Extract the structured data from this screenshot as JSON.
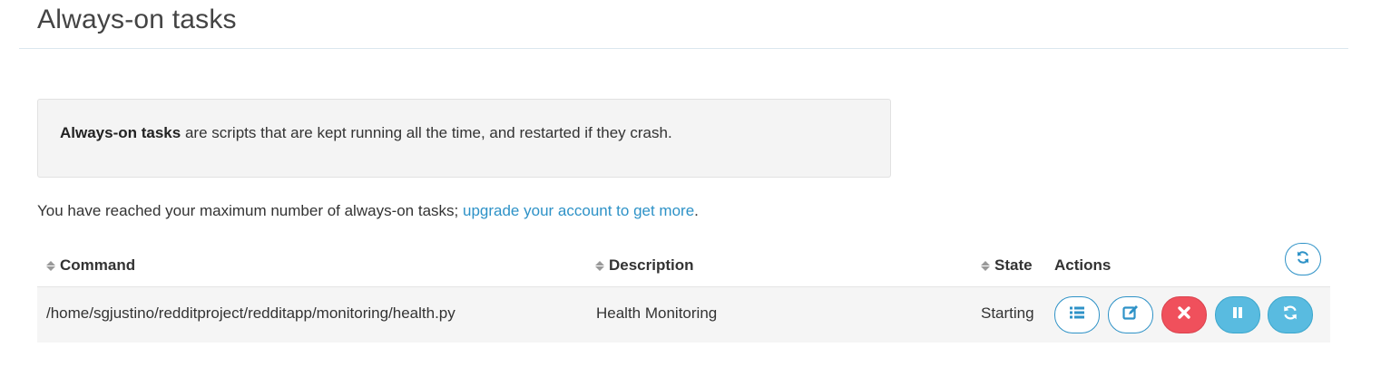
{
  "page": {
    "title": "Always-on tasks"
  },
  "info": {
    "bold": "Always-on tasks",
    "text": " are scripts that are kept running all the time, and restarted if they crash."
  },
  "limit": {
    "text": "You have reached your maximum number of always-on tasks; ",
    "link": "upgrade your account to get more",
    "suffix": "."
  },
  "table": {
    "headers": {
      "command": "Command",
      "description": "Description",
      "state": "State",
      "actions": "Actions"
    },
    "rows": [
      {
        "command": "/home/sgjustino/redditproject/redditapp/monitoring/health.py",
        "description": "Health Monitoring",
        "state": "Starting"
      }
    ]
  },
  "icons": {
    "refresh_all": "refresh-icon",
    "log": "list-icon",
    "edit": "edit-icon",
    "delete": "close-icon",
    "pause": "pause-icon",
    "restart": "refresh-icon"
  },
  "colors": {
    "accent": "#2e92c7",
    "danger": "#f0505c",
    "info": "#59bbe0"
  }
}
